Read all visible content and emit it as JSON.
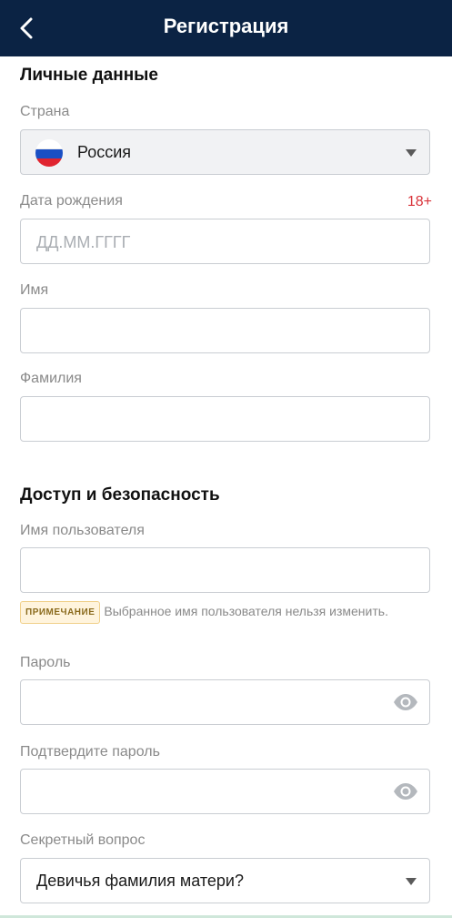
{
  "header": {
    "title": "Регистрация",
    "back_icon": "chevron-left-icon"
  },
  "personal": {
    "section_title": "Личные данные",
    "country": {
      "label": "Страна",
      "value": "Россия",
      "flag_icon": "russia-flag-icon"
    },
    "birth_date": {
      "label": "Дата рождения",
      "age_badge": "18+",
      "placeholder": "ДД.ММ.ГГГГ"
    },
    "first_name": {
      "label": "Имя",
      "value": ""
    },
    "last_name": {
      "label": "Фамилия",
      "value": ""
    }
  },
  "security": {
    "section_title": "Доступ и безопасность",
    "username": {
      "label": "Имя пользователя",
      "value": ""
    },
    "note": {
      "badge": "ПРИМЕЧАНИЕ",
      "text": "Выбранное имя пользователя нельзя изменить."
    },
    "password": {
      "label": "Пароль",
      "value": "",
      "toggle_icon": "eye-icon"
    },
    "confirm_password": {
      "label": "Подтвердите пароль",
      "value": "",
      "toggle_icon": "eye-icon"
    },
    "secret_question": {
      "label": "Секретный вопрос",
      "value": "Девичья фамилия матери?"
    }
  },
  "colors": {
    "header_bg": "#0b2344",
    "age_badge": "#d9343b",
    "field_border": "#c9cdd2"
  }
}
